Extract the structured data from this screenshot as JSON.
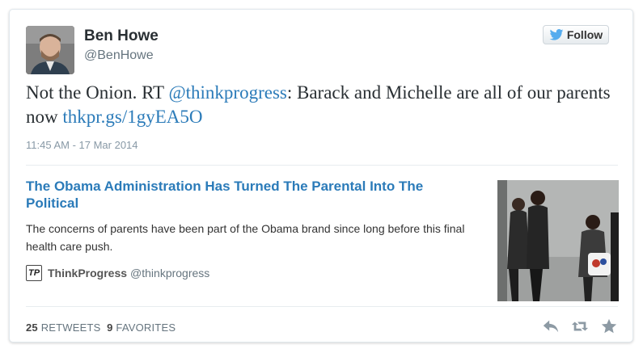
{
  "user": {
    "display_name": "Ben Howe",
    "screen_name": "@BenHowe",
    "avatar_icon": "user-avatar-photo"
  },
  "follow_button": {
    "label": "Follow",
    "icon": "twitter-bird-icon"
  },
  "tweet": {
    "text_prefix": "Not the Onion. RT ",
    "mention": "@thinkprogress",
    "text_middle": ": Barack and Michelle are all of our parents now ",
    "link": "thkpr.gs/1gyEA5O",
    "timestamp": "11:45 AM - 17 Mar 2014"
  },
  "summary_card": {
    "title": "The Obama Administration Has Turned The Parental Into The Political",
    "description": "The concerns of parents have been part of the Obama brand since long before this final health care push.",
    "source_logo": "TP",
    "source_name": "ThinkProgress",
    "source_handle": "@thinkprogress",
    "image": "family-walking-photo"
  },
  "stats": {
    "retweets_count": "25",
    "retweets_label": "RETWEETS",
    "favorites_count": "9",
    "favorites_label": "FAVORITES"
  },
  "actions": [
    "reply-icon",
    "retweet-icon",
    "favorite-icon"
  ],
  "colors": {
    "link": "#2b7bb9",
    "muted": "#8899a6",
    "text": "#292f33",
    "twitter_blue": "#55acee",
    "icon_gray": "#8d9aa4"
  }
}
